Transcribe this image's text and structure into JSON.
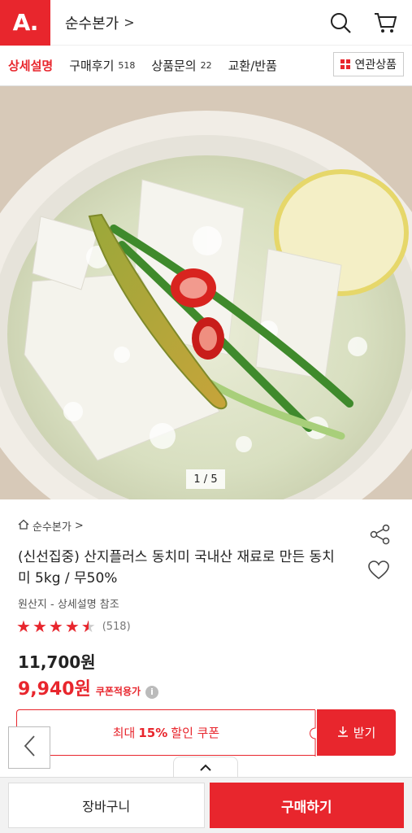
{
  "header": {
    "logo_text": "A.",
    "store_name": "순수본가",
    "chevron": ">",
    "icons": [
      "search-icon",
      "cart-icon"
    ]
  },
  "tabs": [
    {
      "label": "상세설명",
      "count": ""
    },
    {
      "label": "구매후기",
      "count": "518"
    },
    {
      "label": "상품문의",
      "count": "22"
    },
    {
      "label": "교환/반품",
      "count": ""
    }
  ],
  "related_button": {
    "label": "연관상품"
  },
  "image": {
    "page_indicator": "1 / 5"
  },
  "product": {
    "breadcrumb": "순수본가",
    "breadcrumb_chevron": ">",
    "title": "(신선집중) 산지플러스 동치미 국내산 재료로 만든 동치미 5kg / 무50%",
    "origin": "원산지 - 상세설명 참조",
    "rating_stars": 4.5,
    "review_count": "(518)",
    "original_price": "11,700원",
    "sale_price": "9,940원",
    "coupon_label": "쿠폰적용가",
    "info_symbol": "i"
  },
  "coupon": {
    "prefix": "최대",
    "percent": "15%",
    "suffix": "할인 쿠폰",
    "get_label": "받기"
  },
  "bottom": {
    "cart_label": "장바구니",
    "buy_label": "구매하기"
  },
  "colors": {
    "accent": "#e8262d"
  }
}
